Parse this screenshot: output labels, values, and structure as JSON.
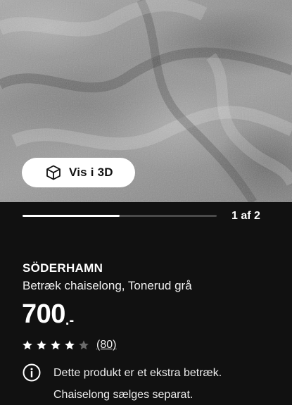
{
  "hero": {
    "view3d_label": "Vis i 3D",
    "view3d_icon": "cube-icon"
  },
  "carousel": {
    "counter": "1 af 2",
    "current": 1,
    "total": 2
  },
  "product": {
    "brand": "SÖDERHAMN",
    "description": "Betræk chaiselong, Tonerud grå",
    "price_amount": "700",
    "price_suffix": ".-",
    "rating": 4,
    "rating_max": 5,
    "review_count": "(80)"
  },
  "notice": {
    "icon": "info-icon",
    "line1": "Dette produkt er et ekstra betræk.",
    "line2": "Chaiselong sælges separat."
  },
  "colors": {
    "background": "#111111",
    "text": "#ffffff",
    "star_filled": "#ffffff",
    "star_empty": "#6b6b6b"
  }
}
